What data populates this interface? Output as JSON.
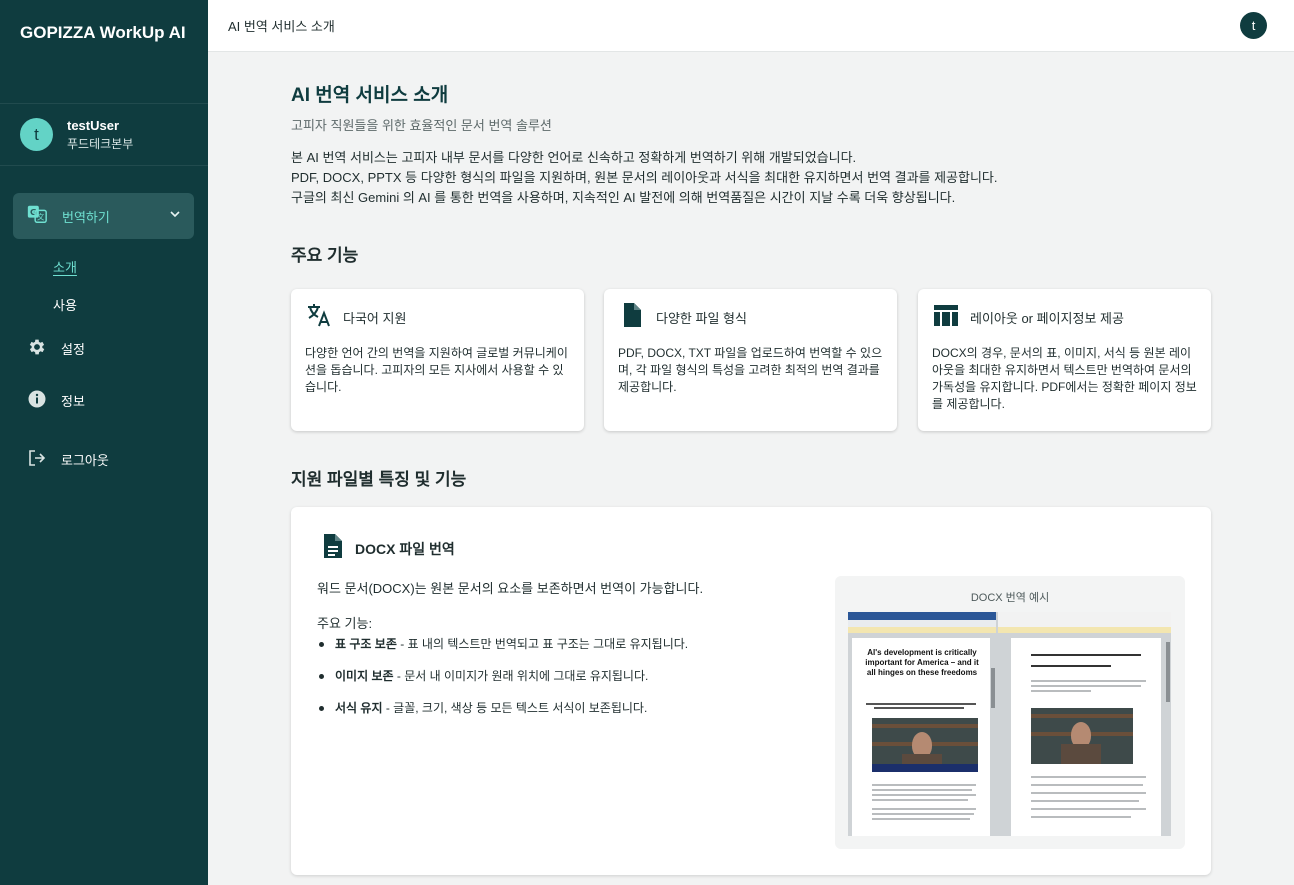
{
  "app": {
    "brand": "GOPIZZA WorkUp AI"
  },
  "user": {
    "initial": "t",
    "name": "testUser",
    "department": "푸드테크본부"
  },
  "sidebar": {
    "group": {
      "label": "번역하기",
      "icon": "translate-icon"
    },
    "sub_items": [
      {
        "label": "소개",
        "active": true
      },
      {
        "label": "사용",
        "active": false
      }
    ],
    "items": [
      {
        "label": "설정",
        "icon": "gear-icon"
      },
      {
        "label": "정보",
        "icon": "info-icon"
      },
      {
        "label": "로그아웃",
        "icon": "logout-icon"
      }
    ]
  },
  "topbar": {
    "breadcrumb": "AI 번역 서비스 소개",
    "avatar_initial": "t"
  },
  "main": {
    "title": "AI 번역 서비스 소개",
    "subtitle": "고피자 직원들을 위한 효율적인 문서 번역 솔루션",
    "intro": [
      "본 AI 번역 서비스는 고피자 내부 문서를 다양한 언어로 신속하고 정확하게 번역하기 위해 개발되었습니다.",
      "PDF, DOCX, PPTX 등 다양한 형식의 파일을 지원하며, 원본 문서의 레이아웃과 서식을 최대한 유지하면서 번역 결과를 제공합니다.",
      "구글의 최신 Gemini 의 AI 를 통한 번역을 사용하며, 지속적인 AI 발전에 의해 번역품질은 시간이 지날 수록 더욱 향상됩니다."
    ],
    "features_title": "주요 기능",
    "features": [
      {
        "icon": "translate-icon",
        "title": "다국어 지원",
        "desc": "다양한 언어 간의 번역을 지원하여 글로벌 커뮤니케이션을 돕습니다. 고피자의 모든 지사에서 사용할 수 있습니다."
      },
      {
        "icon": "file-icon",
        "title": "다양한 파일 형식",
        "desc": "PDF, DOCX, TXT 파일을 업로드하여 번역할 수 있으며, 각 파일 형식의 특성을 고려한 최적의 번역 결과를 제공합니다."
      },
      {
        "icon": "table-layout-icon",
        "title": "레이아웃 or 페이지정보 제공",
        "desc": "DOCX의 경우, 문서의 표, 이미지, 서식 등 원본 레이아웃을 최대한 유지하면서 텍스트만 번역하여 문서의 가독성을 유지합니다. PDF에서는 정확한 페이지 정보를 제공합니다."
      }
    ],
    "files_title": "지원 파일별 특징 및 기능",
    "docx": {
      "icon": "document-icon",
      "title": "DOCX 파일 번역",
      "desc": "워드 문서(DOCX)는 원본 문서의 요소를 보존하면서 번역이 가능합니다.",
      "sub_title": "주요 기능:",
      "points": [
        {
          "bold": "표 구조 보존",
          "text": " - 표 내의 텍스트만 번역되고 표 구조는 그대로 유지됩니다."
        },
        {
          "bold": "이미지 보존",
          "text": " - 문서 내 이미지가 원래 위치에 그대로 유지됩니다."
        },
        {
          "bold": "서식 유지",
          "text": " - 글꼴, 크기, 색상 등 모든 텍스트 서식이 보존됩니다."
        }
      ],
      "example_caption": "DOCX 번역 예시",
      "example_headline": "AI's development is critically important for America – and it all hinges on these freedoms"
    }
  },
  "colors": {
    "sidebar_bg": "#0f3c3f",
    "accent": "#6fe0d1",
    "avatar": "#63d3c6"
  }
}
